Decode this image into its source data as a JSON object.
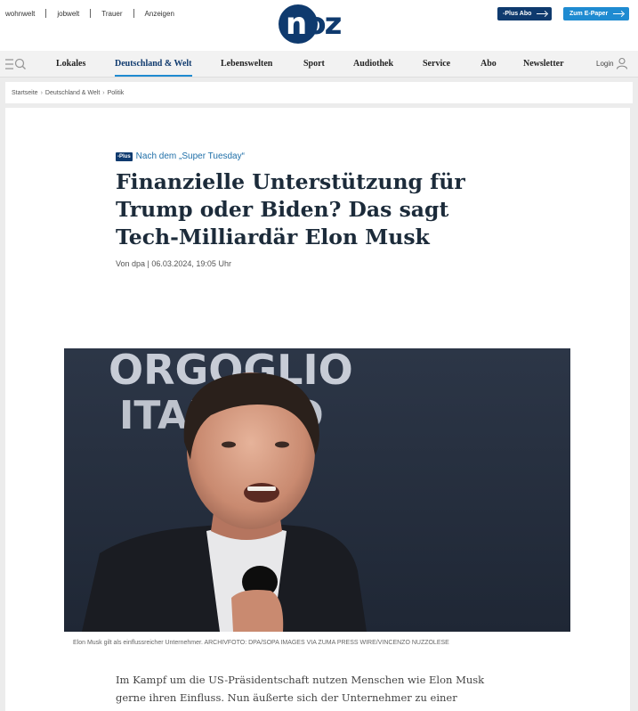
{
  "top_links": [
    "wohnwelt",
    "jobwelt",
    "Trauer",
    "Anzeigen"
  ],
  "logo": {
    "text_left": "n",
    "text_right": "oz"
  },
  "buttons": {
    "plus_abo": "-Plus Abo",
    "epaper": "Zum E-Paper"
  },
  "nav": {
    "items": [
      "Lokales",
      "Deutschland & Welt",
      "Lebenswelten",
      "Sport",
      "Audiothek",
      "Service",
      "Abo",
      "Newsletter"
    ],
    "active": "Deutschland & Welt",
    "login": "Login"
  },
  "breadcrumb": [
    "Startseite",
    "Deutschland & Welt",
    "Politik"
  ],
  "article": {
    "plus_badge": "-Plus",
    "kicker": "Nach dem „Super Tuesday“",
    "headline": "Finanzielle Unterstützung für Trump oder Biden? Das sagt Tech-Milliardär Elon Musk",
    "byline": "Von dpa | 06.03.2024, 19:05 Uhr",
    "image_caption": "Elon Musk gilt als einflussreicher Unternehmer.  ARCHIVFOTO: DPA/SOPA IMAGES VIA ZUMA PRESS WIRE/VINCENZO NUZZOLESE",
    "image_bg_text_1": "ORGOGLIO",
    "image_bg_text_2": "ITALIANO",
    "lead": "Im Kampf um die US-Präsidentschaft nutzen Menschen wie Elon Musk gerne ihren Einfluss. Nun äußerte sich der Unternehmer zu einer"
  },
  "colors": {
    "brand_dark": "#0f3a6e",
    "accent": "#1f8bd1"
  }
}
